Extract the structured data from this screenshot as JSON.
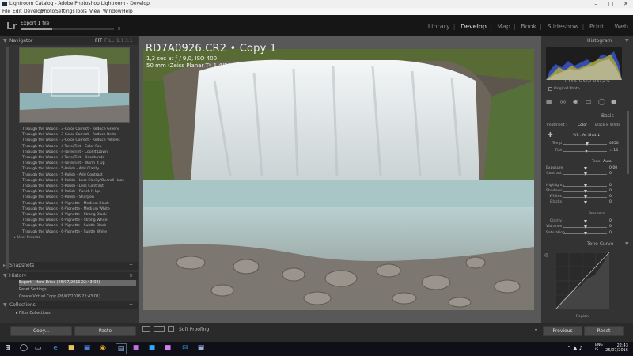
{
  "window": {
    "title": "Lightroom Catalog - Adobe Photoshop Lightroom - Develop"
  },
  "menu": [
    "File",
    "Edit",
    "Develop",
    "Photo",
    "Settings",
    "Tools",
    "View",
    "Window",
    "Help"
  ],
  "identity": {
    "logo": "Lr",
    "export_status": "Export 1 file"
  },
  "modules": [
    "Library",
    "Develop",
    "Map",
    "Book",
    "Slideshow",
    "Print",
    "Web"
  ],
  "active_module": "Develop",
  "left": {
    "navigator": {
      "title": "Navigator",
      "zoom_options": [
        "FIT",
        "FILL",
        "1:1",
        "3:1"
      ]
    },
    "presets": [
      "Through the Woods - 3-Color Correct - Reduce Greens",
      "Through the Woods - 3-Color Correct - Reduce Reds",
      "Through the Woods - 3-Color Correct - Reduce Yellows",
      "Through the Woods - 4-Tone/Tint - Color Pop",
      "Through the Woods - 4-Tone/Tint - Cool It Down",
      "Through the Woods - 4-Tone/Tint - Desaturate",
      "Through the Woods - 4-Tone/Tint - Warm It Up",
      "Through the Woods - 5-Polish - Add Clarity",
      "Through the Woods - 5-Polish - Add Contrast",
      "Through the Woods - 5-Polish - Less Clarity/Overall Haze",
      "Through the Woods - 5-Polish - Less Contrast",
      "Through the Woods - 5-Polish - Punch It Up",
      "Through the Woods - 5-Polish - Sharpen",
      "Through the Woods - 6-Vignette - Medium Black",
      "Through the Woods - 6-Vignette - Medium White",
      "Through the Woods - 6-Vignette - Strong Black",
      "Through the Woods - 6-Vignette - Strong White",
      "Through the Woods - 6-Vignette - Subtle Black",
      "Through the Woods - 6-Vignette - Subtle White"
    ],
    "user_presets": "User Presets",
    "snapshots": "Snapshots",
    "history": {
      "title": "History",
      "items": [
        "Export - Hard Drive (26/07/2016 22:43:02)",
        "Reset Settings",
        "Create Virtual Copy (26/07/2016 22:43:01)"
      ]
    },
    "collections": {
      "title": "Collections",
      "items": [
        "Filter Collections"
      ]
    },
    "copy_label": "Copy...",
    "paste_label": "Paste"
  },
  "photo": {
    "filename": "RD7A0926.CR2  •  Copy 1",
    "exposure_info": "1,3 sec at ƒ / 9,0, ISO 400",
    "lens_info": "50 mm (Zeiss Planar T* 1,4/50 ZE)"
  },
  "toolbar": {
    "soft_proofing": "Soft Proofing"
  },
  "right": {
    "histogram": {
      "title": "Histogram",
      "readout": [
        "59,5",
        "59,9",
        "51,2 %"
      ],
      "original_photo": "Original Photo"
    },
    "basic": {
      "title": "Basic",
      "treatment_label": "Treatment :",
      "color": "Color",
      "bw": "Black & White",
      "wb_label": "WB :",
      "wb_value": "As Shot ↕",
      "sliders": [
        {
          "label": "Temp",
          "value": "4950"
        },
        {
          "label": "Tint",
          "value": "+ 10"
        },
        {
          "label": "Exposure",
          "value": "0,00"
        },
        {
          "label": "Contrast",
          "value": "0"
        },
        {
          "label": "Highlights",
          "value": "0"
        },
        {
          "label": "Shadows",
          "value": "0"
        },
        {
          "label": "Whites",
          "value": "0"
        },
        {
          "label": "Blacks",
          "value": "0"
        },
        {
          "label": "Clarity",
          "value": "0"
        },
        {
          "label": "Vibrance",
          "value": "0"
        },
        {
          "label": "Saturation",
          "value": "0"
        }
      ],
      "tone_label": "Tone",
      "auto_label": "Auto",
      "presence_label": "Presence"
    },
    "tone_curve": {
      "title": "Tone Curve",
      "region_label": "Region"
    },
    "previous_label": "Previous",
    "reset_label": "Reset"
  },
  "taskbar": {
    "lang_top": "ENG",
    "lang_bottom": "IS",
    "time": "22:43",
    "date": "26/07/2016"
  }
}
